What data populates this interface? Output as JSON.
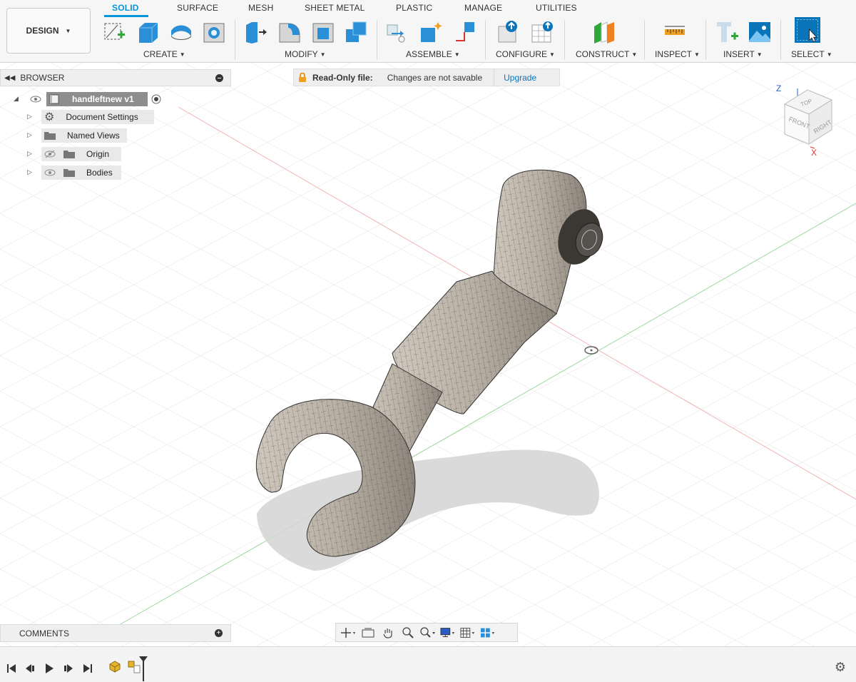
{
  "toolbar": {
    "workspace_button": "DESIGN",
    "tabs": [
      "SOLID",
      "SURFACE",
      "MESH",
      "SHEET METAL",
      "PLASTIC",
      "MANAGE",
      "UTILITIES"
    ],
    "groups": [
      "CREATE",
      "MODIFY",
      "ASSEMBLE",
      "CONFIGURE",
      "CONSTRUCT",
      "INSPECT",
      "INSERT",
      "SELECT"
    ],
    "accent": "#0696d7"
  },
  "browser": {
    "title": "BROWSER",
    "root": "handleftnew v1",
    "items": [
      "Document Settings",
      "Named Views",
      "Origin",
      "Bodies"
    ]
  },
  "notice": {
    "label": "Read-Only file:",
    "message": "Changes are not savable",
    "action": "Upgrade"
  },
  "viewcube": {
    "top": "TOP",
    "front": "FRONT",
    "right": "RIGHT",
    "axis_z": "Z",
    "axis_x": "X"
  },
  "comments": {
    "title": "COMMENTS"
  }
}
